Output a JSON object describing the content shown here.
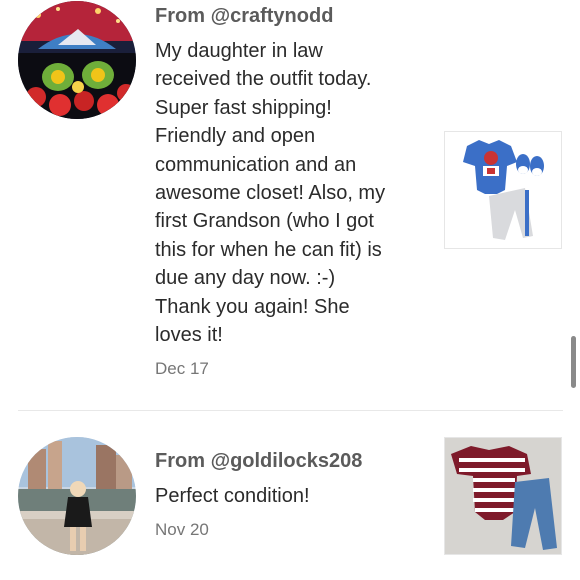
{
  "reviews": [
    {
      "from_prefix": "From",
      "handle": "@craftynodd",
      "message_lines": [
        "My daughter in law",
        "received the outfit today.",
        "Super fast shipping!",
        "Friendly and open",
        "communication and an",
        "awesome closet! Also, my",
        "first Grandson (who I got",
        "this for when he can fit) is",
        "due any day now. :-)",
        "Thank you again! She",
        "loves it!"
      ],
      "date": "Dec 17"
    },
    {
      "from_prefix": "From",
      "handle": "@goldilocks208",
      "message_lines": [
        "Perfect condition!"
      ],
      "date": "Nov 20"
    }
  ],
  "colors": {
    "text_primary": "#2b2b2b",
    "text_secondary": "#5b5b5b",
    "date": "#767676",
    "divider": "#e8e8e8",
    "scrollbar": "#8a8a8a"
  }
}
